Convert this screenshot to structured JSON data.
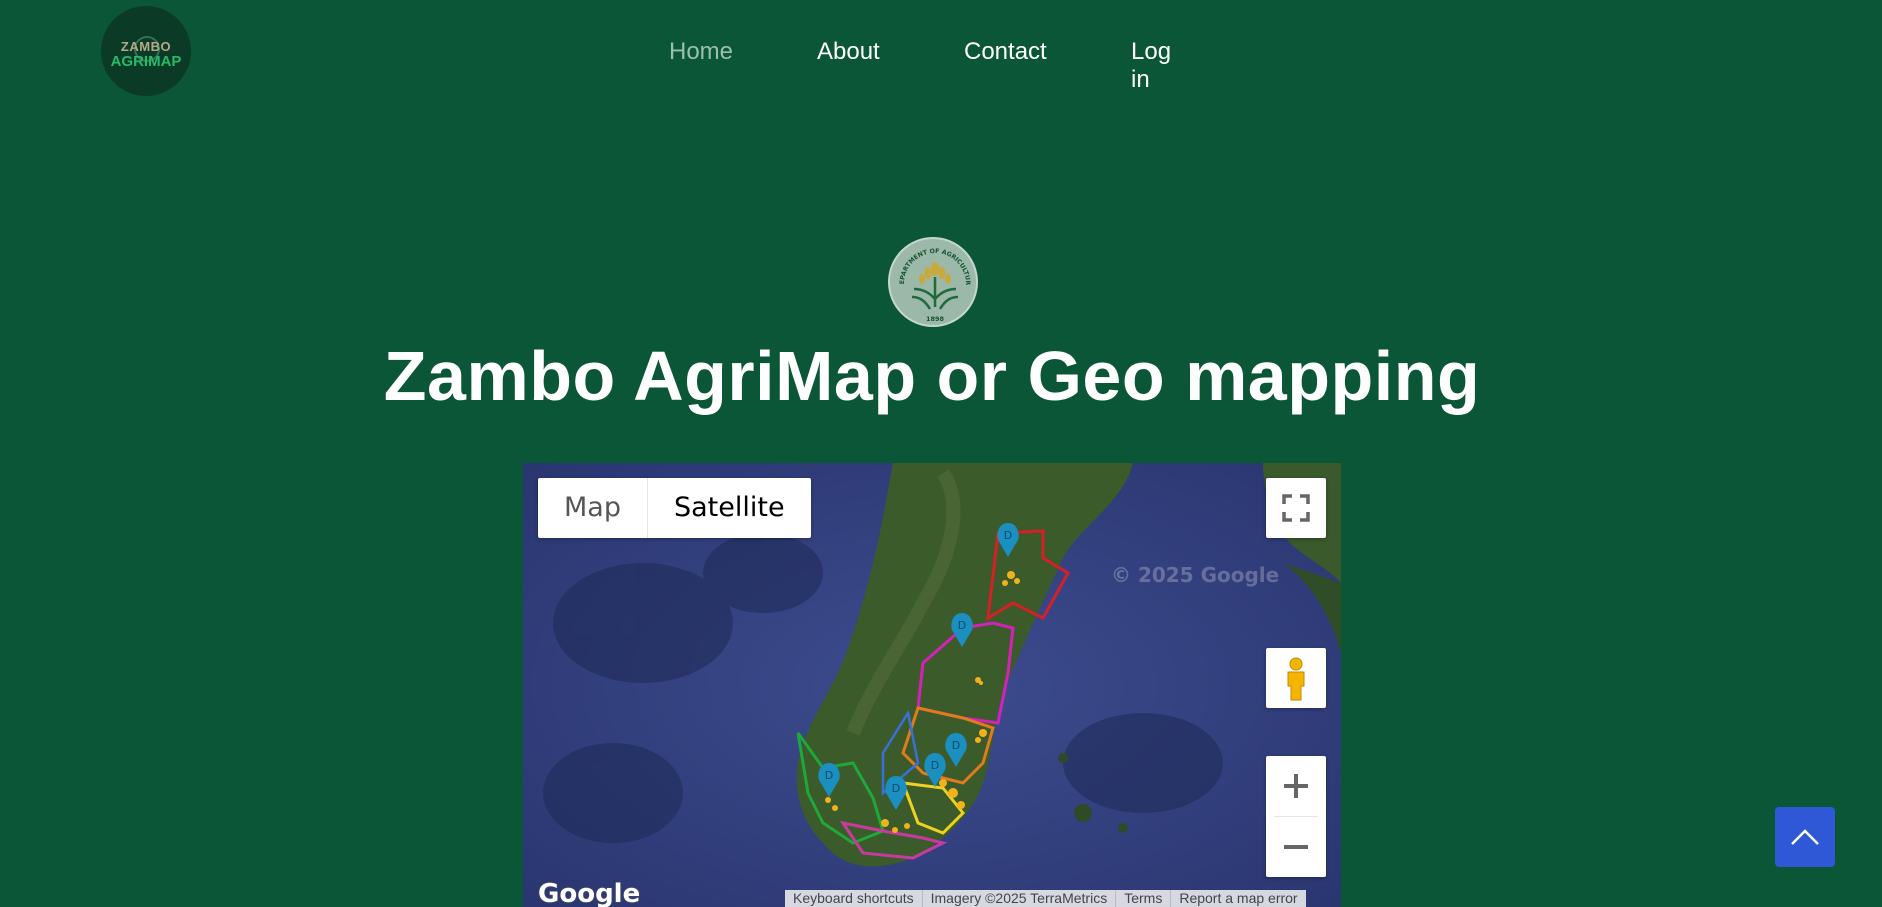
{
  "nav": {
    "items": [
      {
        "label": "Home",
        "active": true
      },
      {
        "label": "About",
        "active": false
      },
      {
        "label": "Contact",
        "active": false
      },
      {
        "label": "Log in",
        "active": false
      }
    ]
  },
  "logo": {
    "line1": "ZAMBO",
    "line2": "AGRIMAP"
  },
  "seal": {
    "top_text": "DEPARTMENT OF AGRICULTURE",
    "year": "1898"
  },
  "hero": {
    "title": "Zambo AgriMap or Geo mapping"
  },
  "map": {
    "type_buttons": {
      "map": "Map",
      "satellite": "Satellite",
      "selected": "Satellite"
    },
    "watermark": "© 2025 Google",
    "google_logo": "Google",
    "attribution": [
      "Keyboard shortcuts",
      "Imagery ©2025 TerraMetrics",
      "Terms",
      "Report a map error"
    ],
    "controls": {
      "fullscreen_icon": "fullscreen-icon",
      "pegman_icon": "pegman-icon",
      "zoom_in": "+",
      "zoom_out": "−"
    },
    "marker_label": "D"
  },
  "colors": {
    "background": "#0a5636",
    "accent_button": "#2e58d6",
    "nav_active": "#9bbfae"
  }
}
